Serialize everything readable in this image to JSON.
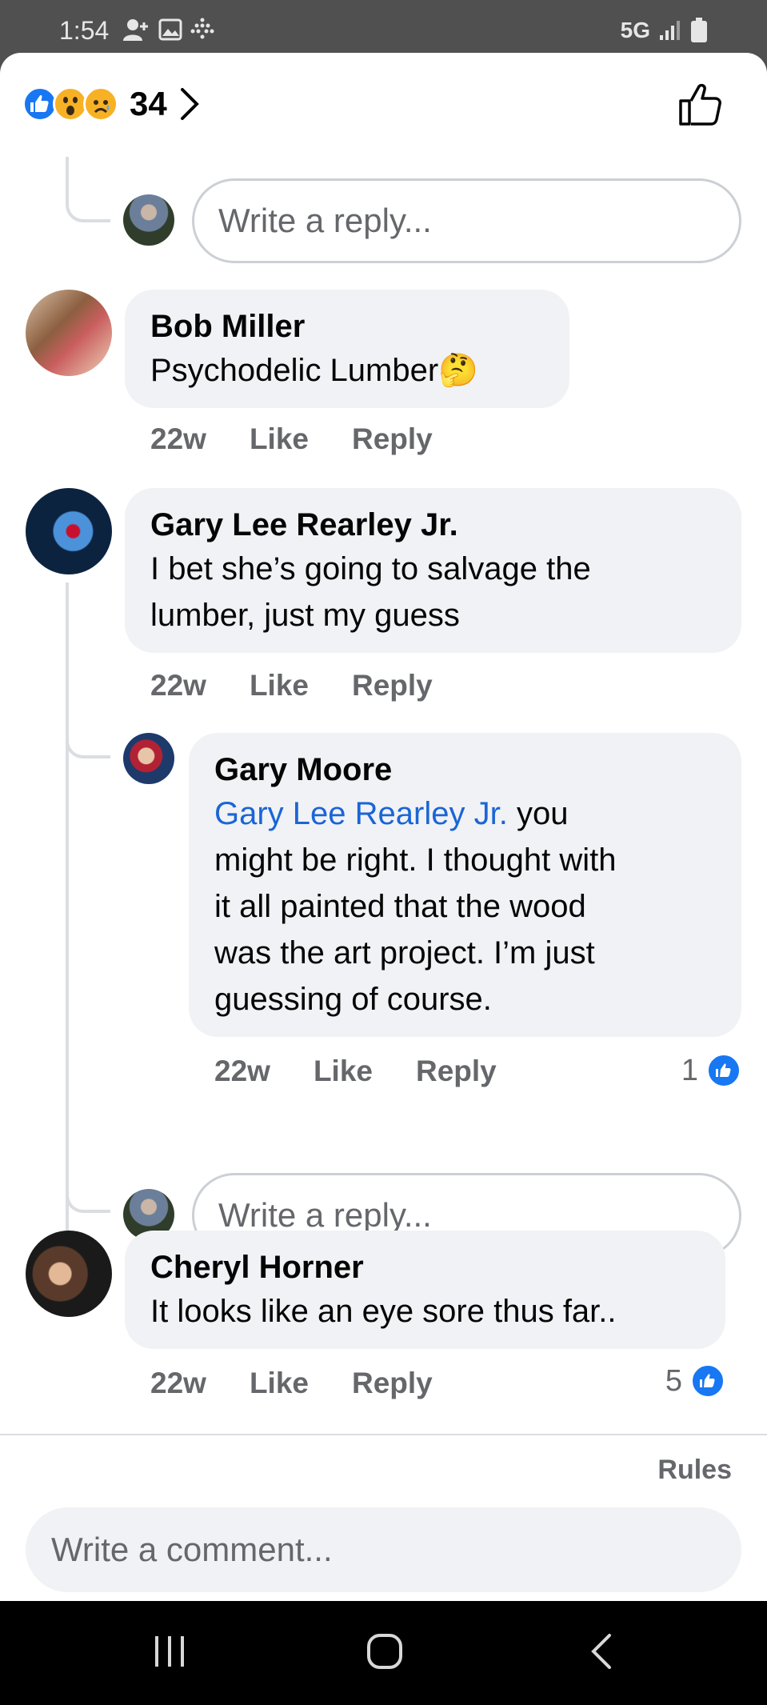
{
  "status_bar": {
    "time": "1:54",
    "network": "5G"
  },
  "reactions": {
    "count": "34",
    "types": [
      "like",
      "wow",
      "sad"
    ]
  },
  "comments": [
    {
      "author": "Bob Miller",
      "text": "Psychodelic Lumber",
      "emoji": "🤔",
      "age": "22w",
      "like_label": "Like",
      "reply_label": "Reply"
    },
    {
      "author": "Gary Lee Rearley Jr.",
      "text_lines": [
        "I bet she’s going to salvage the",
        "lumber, just my guess"
      ],
      "age": "22w",
      "like_label": "Like",
      "reply_label": "Reply",
      "replies": [
        {
          "author": "Gary Moore",
          "mention": "Gary Lee Rearley Jr.",
          "line1_rest": " you",
          "text_lines": [
            "might be right. I thought with",
            "it all painted that the wood",
            "was the art project. I’m just",
            "guessing of course."
          ],
          "age": "22w",
          "like_label": "Like",
          "reply_label": "Reply",
          "like_count": "1"
        }
      ]
    },
    {
      "author": "Cheryl Horner",
      "text": "It looks like an eye sore thus far..",
      "age": "22w",
      "like_label": "Like",
      "reply_label": "Reply",
      "like_count": "5"
    }
  ],
  "reply_placeholder": "Write a reply...",
  "footer": {
    "rules_label": "Rules",
    "comment_placeholder": "Write a comment..."
  },
  "colors": {
    "accent": "#1877f2",
    "mention": "#1b65d6",
    "bubble": "#f0f2f5",
    "muted": "#65676b"
  },
  "icons": [
    "like-reaction-icon",
    "wow-reaction-icon",
    "sad-reaction-icon",
    "chevron-right-icon",
    "thumbs-up-icon",
    "recents-icon",
    "home-icon",
    "back-icon"
  ]
}
